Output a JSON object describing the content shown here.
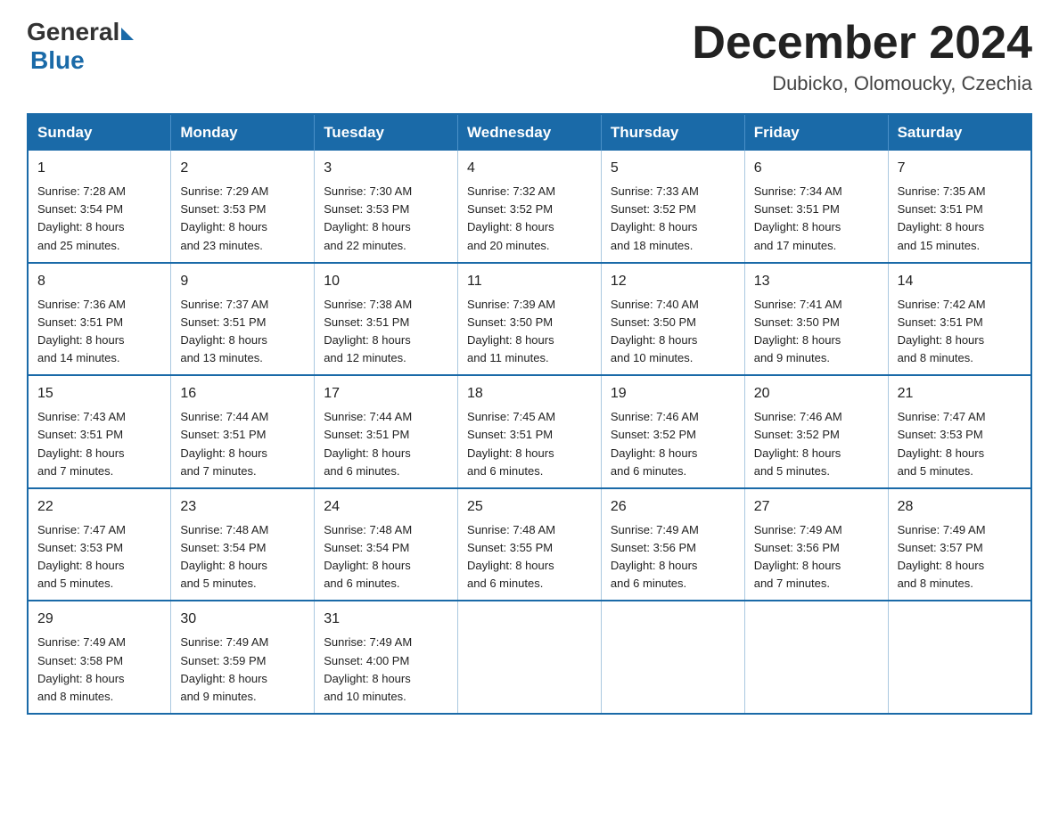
{
  "logo": {
    "general": "General",
    "blue": "Blue"
  },
  "header": {
    "month": "December 2024",
    "location": "Dubicko, Olomoucky, Czechia"
  },
  "weekdays": [
    "Sunday",
    "Monday",
    "Tuesday",
    "Wednesday",
    "Thursday",
    "Friday",
    "Saturday"
  ],
  "weeks": [
    [
      {
        "day": "1",
        "sunrise": "7:28 AM",
        "sunset": "3:54 PM",
        "daylight": "8 hours and 25 minutes."
      },
      {
        "day": "2",
        "sunrise": "7:29 AM",
        "sunset": "3:53 PM",
        "daylight": "8 hours and 23 minutes."
      },
      {
        "day": "3",
        "sunrise": "7:30 AM",
        "sunset": "3:53 PM",
        "daylight": "8 hours and 22 minutes."
      },
      {
        "day": "4",
        "sunrise": "7:32 AM",
        "sunset": "3:52 PM",
        "daylight": "8 hours and 20 minutes."
      },
      {
        "day": "5",
        "sunrise": "7:33 AM",
        "sunset": "3:52 PM",
        "daylight": "8 hours and 18 minutes."
      },
      {
        "day": "6",
        "sunrise": "7:34 AM",
        "sunset": "3:51 PM",
        "daylight": "8 hours and 17 minutes."
      },
      {
        "day": "7",
        "sunrise": "7:35 AM",
        "sunset": "3:51 PM",
        "daylight": "8 hours and 15 minutes."
      }
    ],
    [
      {
        "day": "8",
        "sunrise": "7:36 AM",
        "sunset": "3:51 PM",
        "daylight": "8 hours and 14 minutes."
      },
      {
        "day": "9",
        "sunrise": "7:37 AM",
        "sunset": "3:51 PM",
        "daylight": "8 hours and 13 minutes."
      },
      {
        "day": "10",
        "sunrise": "7:38 AM",
        "sunset": "3:51 PM",
        "daylight": "8 hours and 12 minutes."
      },
      {
        "day": "11",
        "sunrise": "7:39 AM",
        "sunset": "3:50 PM",
        "daylight": "8 hours and 11 minutes."
      },
      {
        "day": "12",
        "sunrise": "7:40 AM",
        "sunset": "3:50 PM",
        "daylight": "8 hours and 10 minutes."
      },
      {
        "day": "13",
        "sunrise": "7:41 AM",
        "sunset": "3:50 PM",
        "daylight": "8 hours and 9 minutes."
      },
      {
        "day": "14",
        "sunrise": "7:42 AM",
        "sunset": "3:51 PM",
        "daylight": "8 hours and 8 minutes."
      }
    ],
    [
      {
        "day": "15",
        "sunrise": "7:43 AM",
        "sunset": "3:51 PM",
        "daylight": "8 hours and 7 minutes."
      },
      {
        "day": "16",
        "sunrise": "7:44 AM",
        "sunset": "3:51 PM",
        "daylight": "8 hours and 7 minutes."
      },
      {
        "day": "17",
        "sunrise": "7:44 AM",
        "sunset": "3:51 PM",
        "daylight": "8 hours and 6 minutes."
      },
      {
        "day": "18",
        "sunrise": "7:45 AM",
        "sunset": "3:51 PM",
        "daylight": "8 hours and 6 minutes."
      },
      {
        "day": "19",
        "sunrise": "7:46 AM",
        "sunset": "3:52 PM",
        "daylight": "8 hours and 6 minutes."
      },
      {
        "day": "20",
        "sunrise": "7:46 AM",
        "sunset": "3:52 PM",
        "daylight": "8 hours and 5 minutes."
      },
      {
        "day": "21",
        "sunrise": "7:47 AM",
        "sunset": "3:53 PM",
        "daylight": "8 hours and 5 minutes."
      }
    ],
    [
      {
        "day": "22",
        "sunrise": "7:47 AM",
        "sunset": "3:53 PM",
        "daylight": "8 hours and 5 minutes."
      },
      {
        "day": "23",
        "sunrise": "7:48 AM",
        "sunset": "3:54 PM",
        "daylight": "8 hours and 5 minutes."
      },
      {
        "day": "24",
        "sunrise": "7:48 AM",
        "sunset": "3:54 PM",
        "daylight": "8 hours and 6 minutes."
      },
      {
        "day": "25",
        "sunrise": "7:48 AM",
        "sunset": "3:55 PM",
        "daylight": "8 hours and 6 minutes."
      },
      {
        "day": "26",
        "sunrise": "7:49 AM",
        "sunset": "3:56 PM",
        "daylight": "8 hours and 6 minutes."
      },
      {
        "day": "27",
        "sunrise": "7:49 AM",
        "sunset": "3:56 PM",
        "daylight": "8 hours and 7 minutes."
      },
      {
        "day": "28",
        "sunrise": "7:49 AM",
        "sunset": "3:57 PM",
        "daylight": "8 hours and 8 minutes."
      }
    ],
    [
      {
        "day": "29",
        "sunrise": "7:49 AM",
        "sunset": "3:58 PM",
        "daylight": "8 hours and 8 minutes."
      },
      {
        "day": "30",
        "sunrise": "7:49 AM",
        "sunset": "3:59 PM",
        "daylight": "8 hours and 9 minutes."
      },
      {
        "day": "31",
        "sunrise": "7:49 AM",
        "sunset": "4:00 PM",
        "daylight": "8 hours and 10 minutes."
      },
      null,
      null,
      null,
      null
    ]
  ],
  "labels": {
    "sunrise": "Sunrise:",
    "sunset": "Sunset:",
    "daylight": "Daylight:"
  }
}
